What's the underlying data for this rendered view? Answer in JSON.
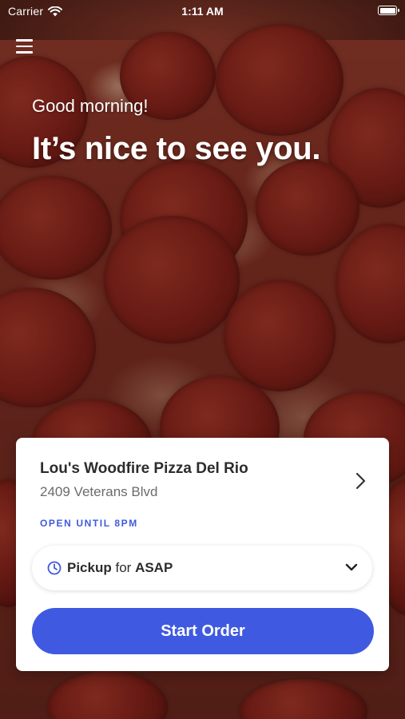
{
  "status_bar": {
    "carrier": "Carrier",
    "time": "1:11 AM",
    "wifi_icon": "wifi-icon",
    "battery_icon": "battery-icon"
  },
  "menu": {
    "icon": "hamburger-menu-icon"
  },
  "greeting": {
    "subtitle": "Good morning!",
    "title": "It’s nice to see you."
  },
  "store": {
    "name": "Lou's Woodfire Pizza Del Rio",
    "address": "2409 Veterans Blvd",
    "status": "OPEN UNTIL 8PM",
    "status_color": "#3f5ae0"
  },
  "order_mode": {
    "mode": "Pickup",
    "connector": "for",
    "when": "ASAP",
    "icon": "clock-icon"
  },
  "cta": {
    "label": "Start Order",
    "color": "#3f5ae0"
  }
}
